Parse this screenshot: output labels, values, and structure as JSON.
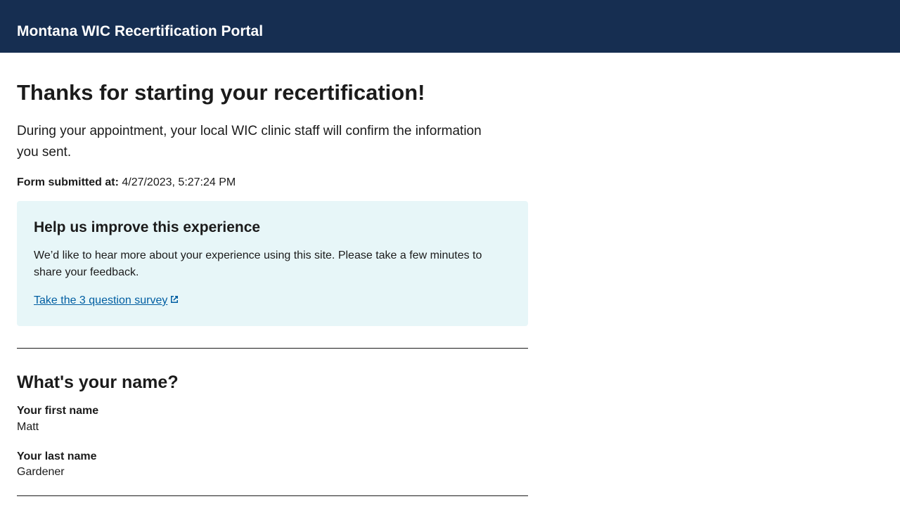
{
  "header": {
    "title": "Montana WIC Recertification Portal"
  },
  "main": {
    "title": "Thanks for starting your recertification!",
    "intro": "During your appointment, your local WIC clinic staff will confirm the information you sent.",
    "submitted_label": "Form submitted at:",
    "submitted_value": "4/27/2023, 5:27:24 PM"
  },
  "feedback": {
    "heading": "Help us improve this experience",
    "text": "We’d like to hear more about your experience using this site. Please take a few minutes to share your feedback.",
    "link_label": "Take the 3 question survey",
    "link_icon": "external-link-icon"
  },
  "name_section": {
    "heading": "What's your name?",
    "first_name_label": "Your first name",
    "first_name_value": "Matt",
    "last_name_label": "Your last name",
    "last_name_value": "Gardener"
  },
  "colors": {
    "header_bg": "#162e51",
    "feedback_bg": "#e7f6f8",
    "link": "#005ea2"
  }
}
